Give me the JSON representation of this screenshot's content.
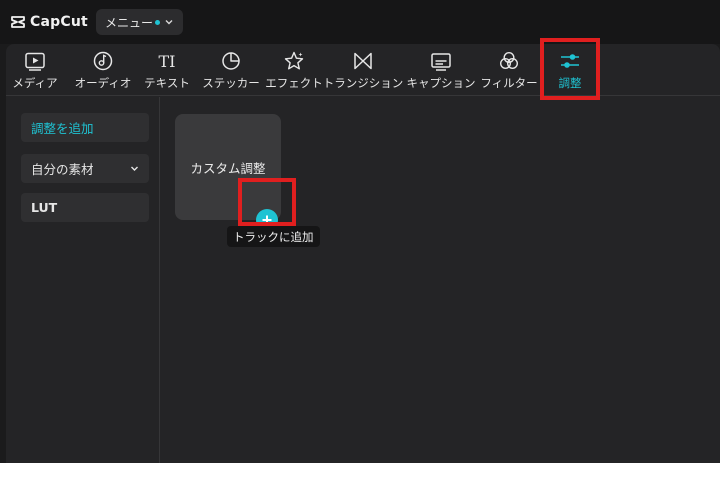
{
  "app": {
    "name": "CapCut"
  },
  "menu": {
    "label": "メニュー"
  },
  "tabs": [
    {
      "label": "メディア",
      "icon": "media-icon"
    },
    {
      "label": "オーディオ",
      "icon": "audio-icon"
    },
    {
      "label": "テキスト",
      "icon": "text-icon",
      "glyph": "TI"
    },
    {
      "label": "ステッカー",
      "icon": "sticker-icon"
    },
    {
      "label": "エフェクト",
      "icon": "effect-icon"
    },
    {
      "label": "トランジション",
      "icon": "transition-icon"
    },
    {
      "label": "キャプション",
      "icon": "caption-icon"
    },
    {
      "label": "フィルター",
      "icon": "filter-icon"
    },
    {
      "label": "調整",
      "icon": "adjust-icon",
      "active": true
    }
  ],
  "sidebar": {
    "items": [
      {
        "label": "調整を追加",
        "active": true
      },
      {
        "label": "自分の素材",
        "expandable": true
      },
      {
        "label": "LUT"
      }
    ]
  },
  "content": {
    "card_title": "カスタム調整",
    "add_tooltip": "トラックに追加"
  },
  "colors": {
    "accent": "#1fc3d3",
    "highlight": "#e01f1f",
    "background": "#1b1b1c",
    "panel": "#242426"
  }
}
